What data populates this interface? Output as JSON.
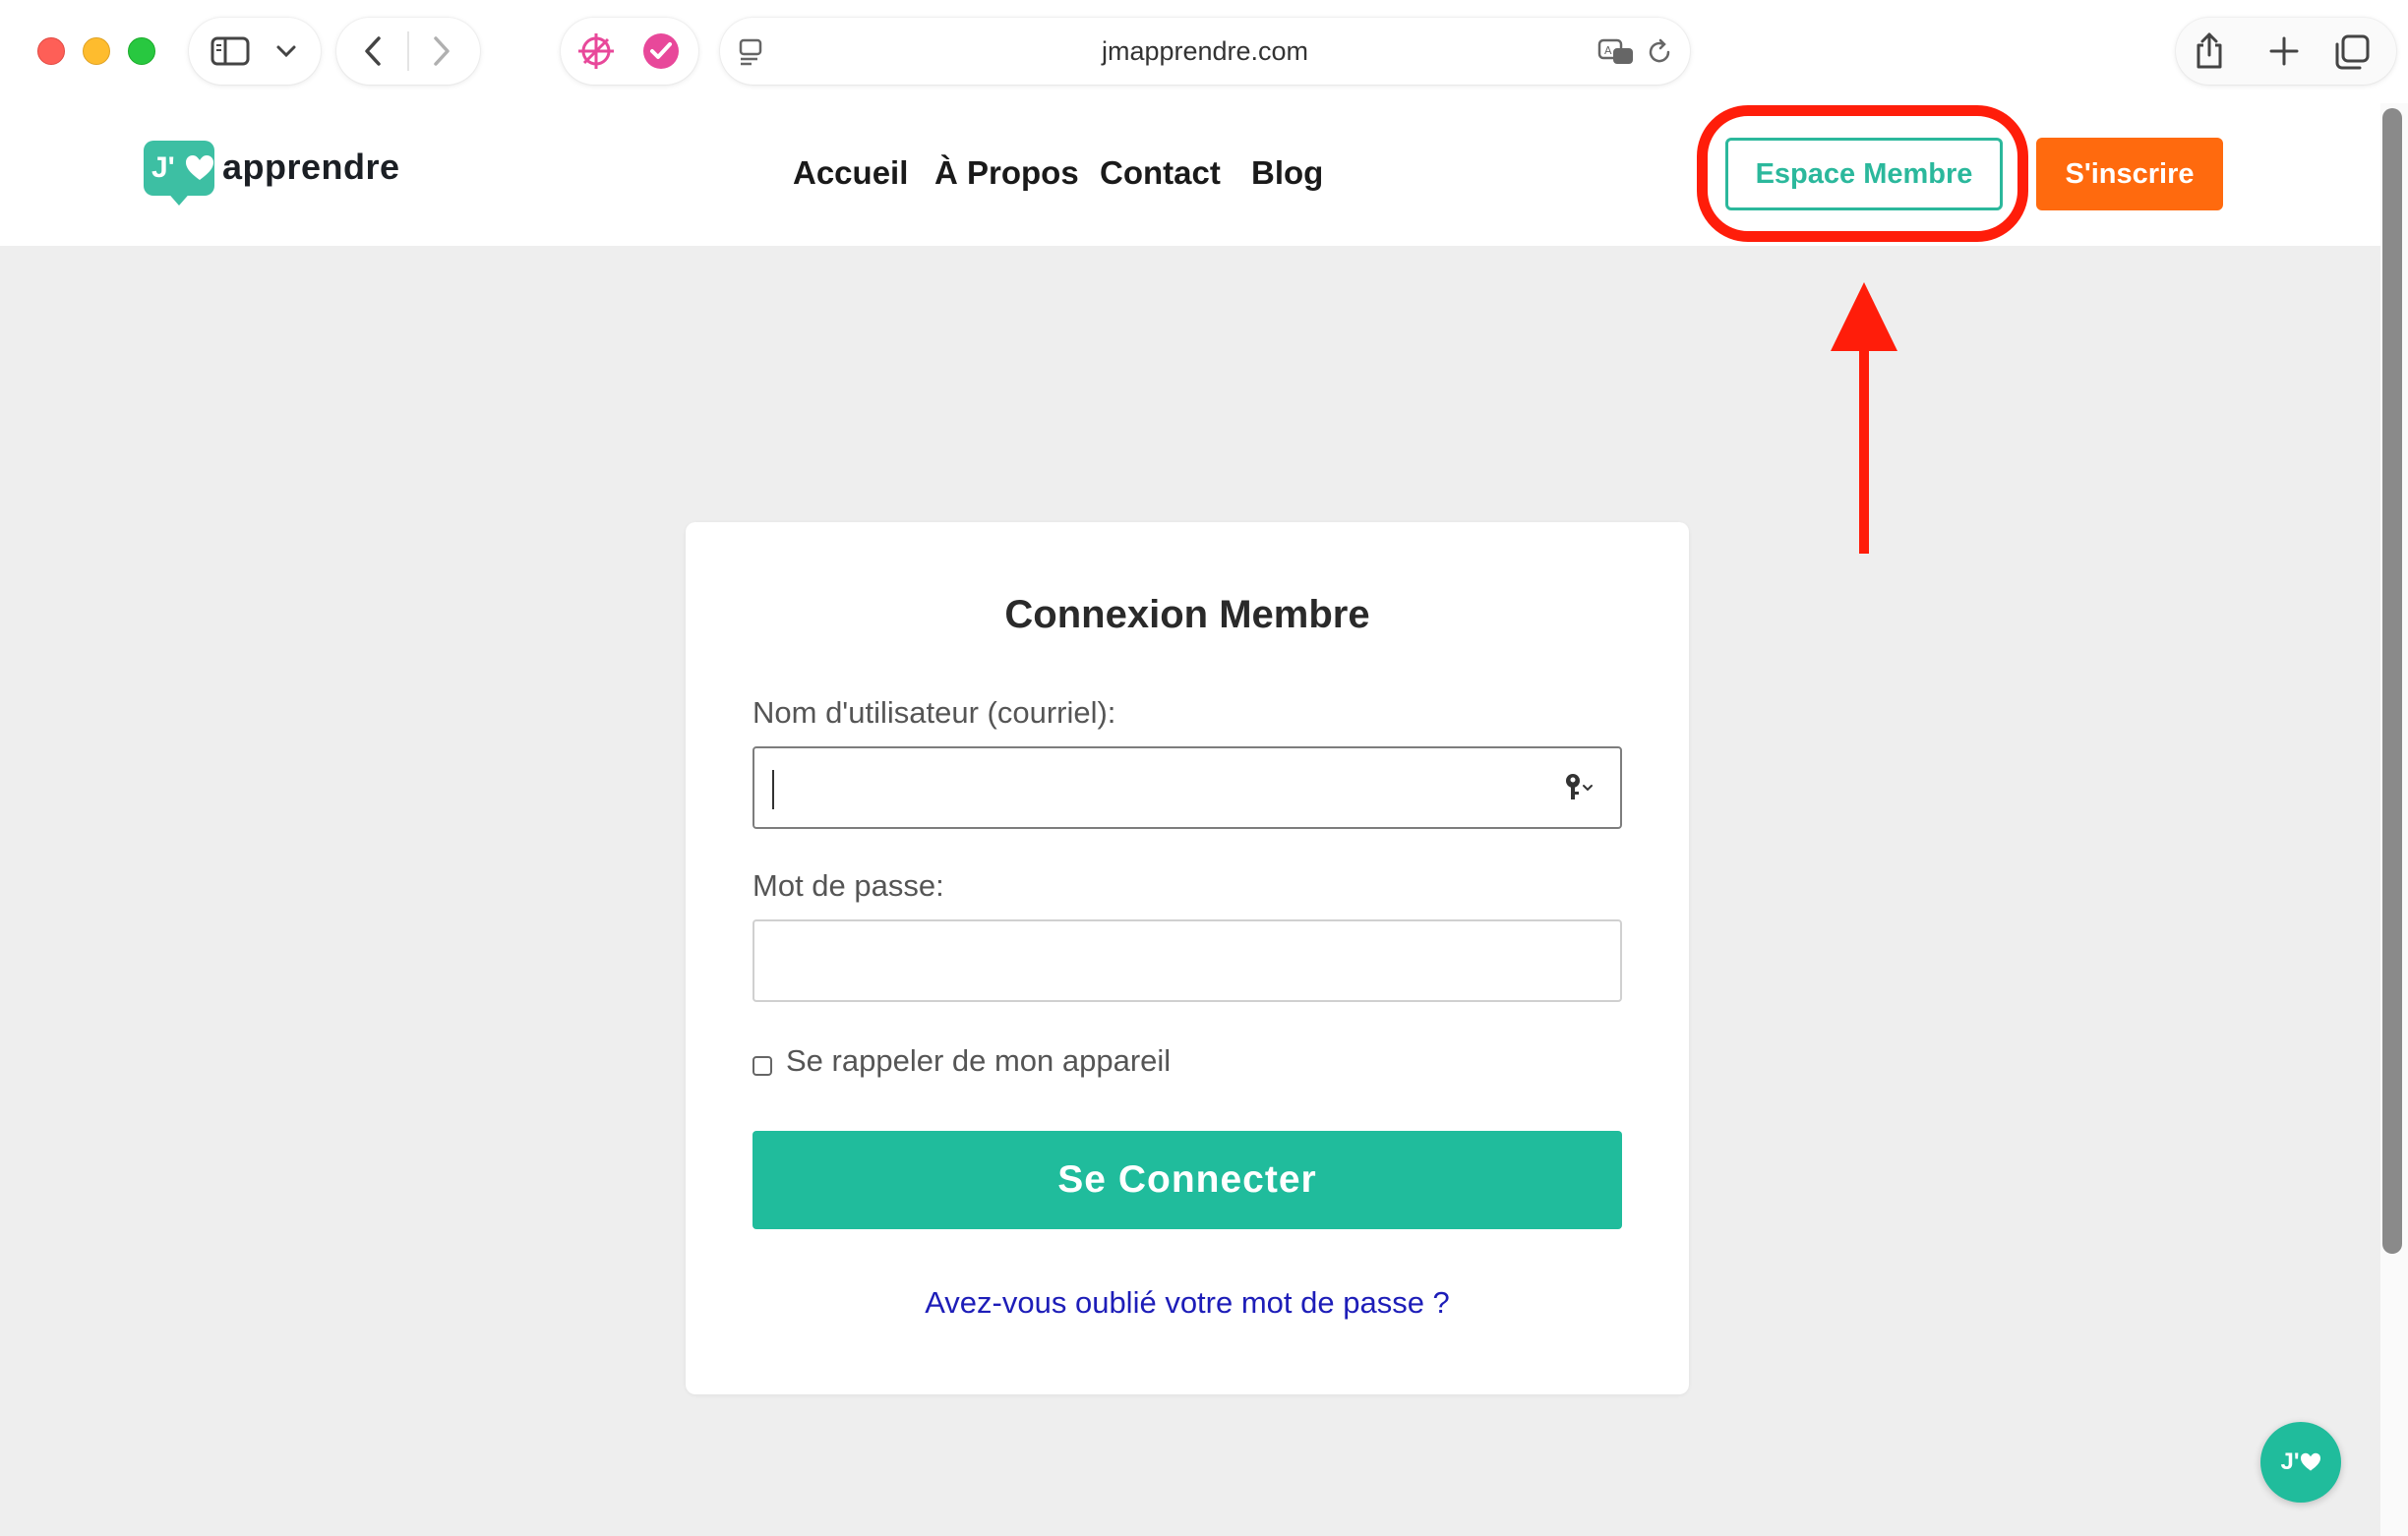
{
  "browser": {
    "url": "jmapprendre.com"
  },
  "site": {
    "logo_badge": "J'",
    "logo_word": "apprendre",
    "nav": [
      "Accueil",
      "À Propos",
      "Contact",
      "Blog"
    ],
    "member_button": "Espace Membre",
    "signup_button": "S'inscrire"
  },
  "login": {
    "title": "Connexion Membre",
    "username_label": "Nom d'utilisateur (courriel):",
    "username_value": "",
    "password_label": "Mot de passe:",
    "password_value": "",
    "remember_label": "Se rappeler de mon appareil",
    "remember_checked": false,
    "submit_label": "Se Connecter",
    "forgot_link": "Avez-vous oublié votre mot de passe ?"
  },
  "chat": {
    "label": "J'"
  },
  "colors": {
    "brand_teal": "#20bc9c",
    "signup_orange": "#ff6a0e",
    "annotation_red": "#ff1d0a",
    "link_blue": "#1d1db8"
  }
}
